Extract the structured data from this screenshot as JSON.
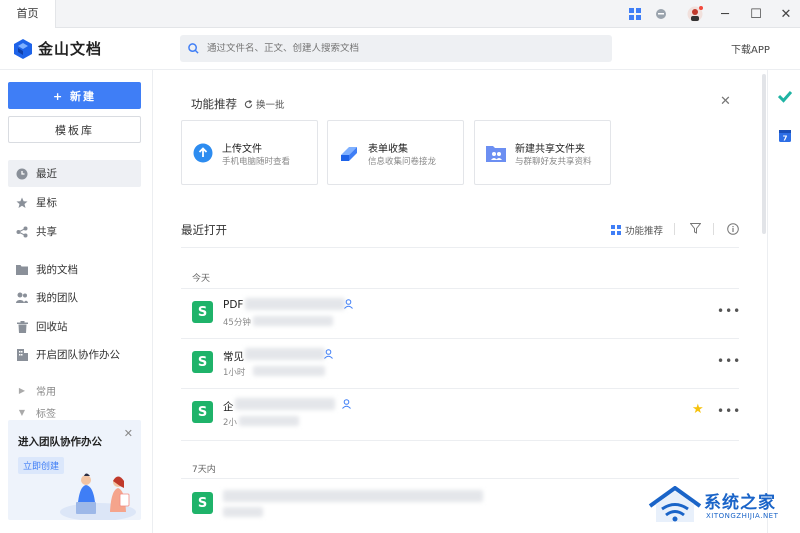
{
  "titlebar": {
    "tab_label": "首页"
  },
  "header": {
    "logo_name": "金山文档",
    "search_placeholder": "通过文件名、正文、创建人搜索文档",
    "download_label": "下载APP"
  },
  "sidebar": {
    "new_label": "+ 新建",
    "template_label": "模板库",
    "items": [
      {
        "label": "最近",
        "icon": "clock-icon"
      },
      {
        "label": "星标",
        "icon": "star-icon"
      },
      {
        "label": "共享",
        "icon": "share-icon"
      },
      {
        "label": "我的文档",
        "icon": "folder-icon"
      },
      {
        "label": "我的团队",
        "icon": "team-icon"
      },
      {
        "label": "回收站",
        "icon": "trash-icon"
      },
      {
        "label": "开启团队协作办公",
        "icon": "building-icon"
      }
    ],
    "sections": [
      {
        "label": "常用"
      },
      {
        "label": "标签"
      }
    ],
    "promo": {
      "title": "进入团队协作办公",
      "button": "立即创建"
    }
  },
  "features": {
    "title": "功能推荐",
    "refresh_label": "换一批",
    "cards": [
      {
        "title": "上传文件",
        "subtitle": "手机电脑随时查看",
        "icon": "upload-icon",
        "color": "#2d8cf0"
      },
      {
        "title": "表单收集",
        "subtitle": "信息收集问卷接龙",
        "icon": "form-icon",
        "color": "#3f7ef6"
      },
      {
        "title": "新建共享文件夹",
        "subtitle": "与群聊好友共享资料",
        "icon": "shared-folder-icon",
        "color": "#6c8ff2"
      }
    ]
  },
  "recent": {
    "title": "最近打开",
    "tool_feature_label": "功能推荐",
    "groups": [
      {
        "label": "今天"
      },
      {
        "label": "7天内"
      }
    ],
    "files": [
      {
        "name": "PDF",
        "meta": "45分钟"
      },
      {
        "name": "常见",
        "meta": "1小时"
      },
      {
        "name": "企",
        "meta": "2小"
      },
      {
        "name": "",
        "meta": ""
      }
    ]
  },
  "watermark": {
    "text": "系统之家",
    "sub": "XITONGZHIJIA.NET"
  }
}
